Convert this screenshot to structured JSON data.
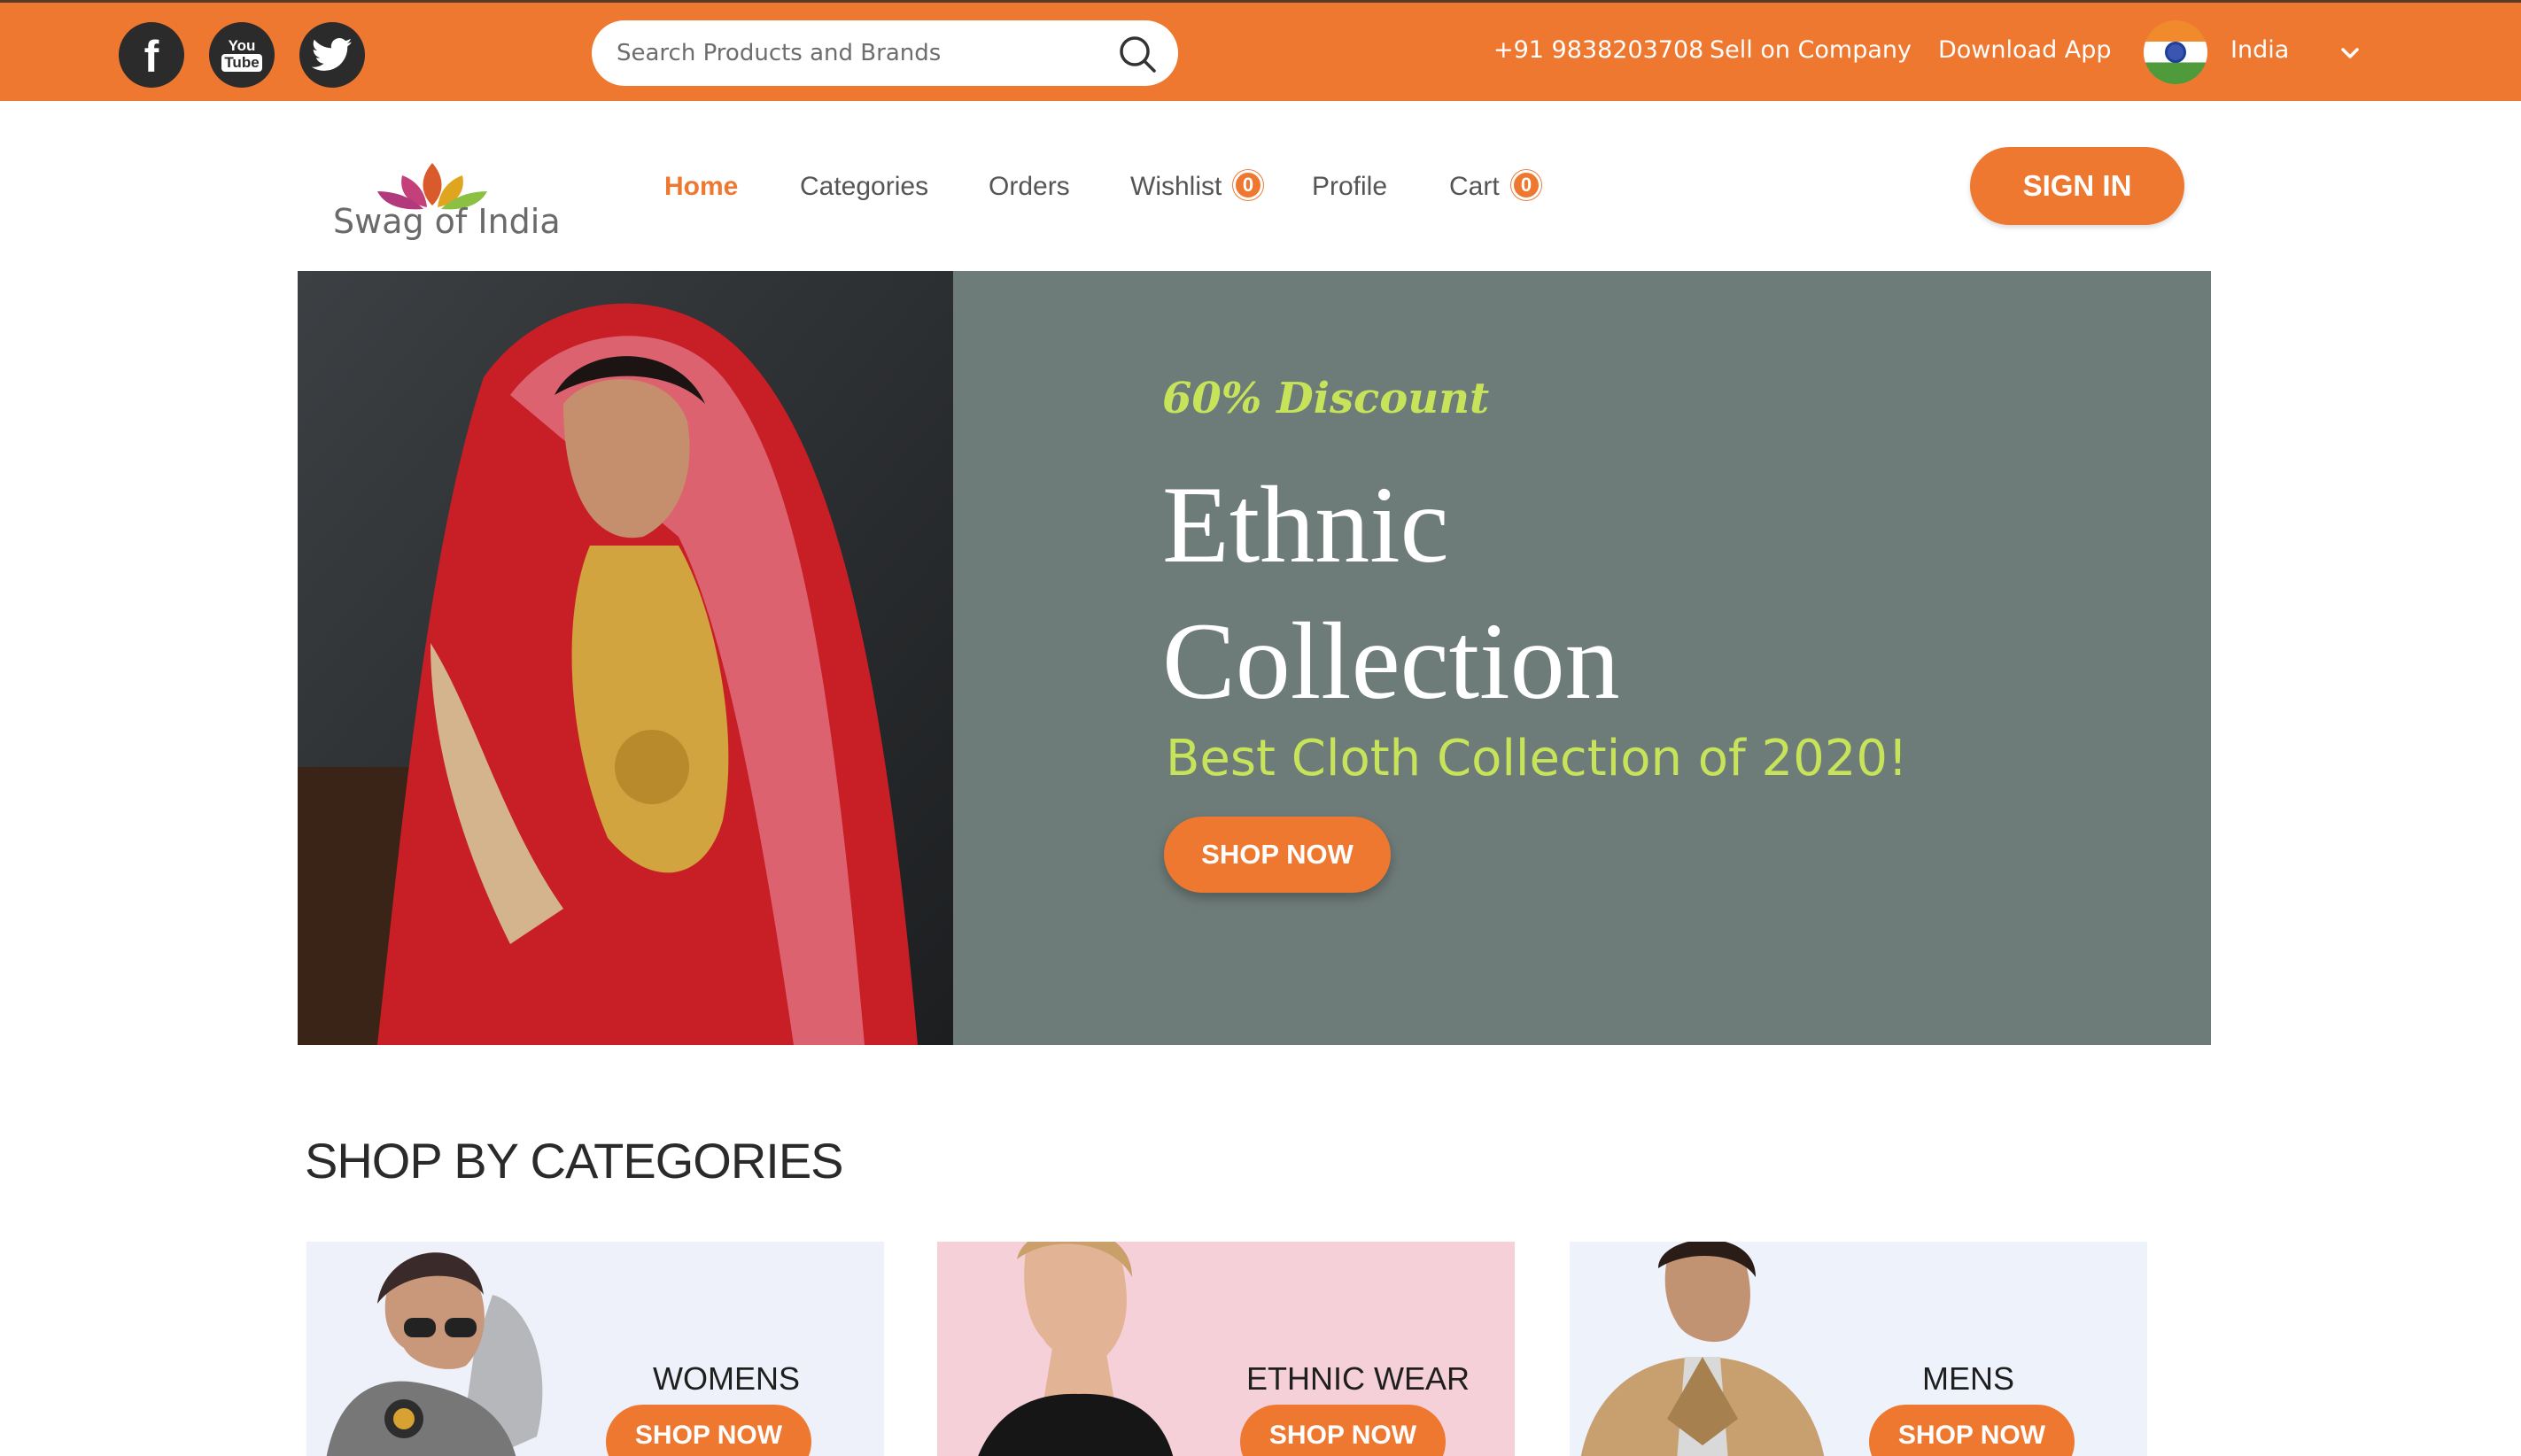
{
  "colors": {
    "brand_orange": "#ef7830",
    "lime_accent": "#c6e35a",
    "hero_bg": "#6d7b79",
    "social_icon_bg": "#2b2b2b"
  },
  "topbar": {
    "social": [
      {
        "name": "facebook-icon",
        "glyph": "f"
      },
      {
        "name": "youtube-icon",
        "glyph_top": "You",
        "glyph_bottom": "Tube"
      },
      {
        "name": "twitter-icon"
      }
    ],
    "search": {
      "placeholder": "Search Products and Brands",
      "value": ""
    },
    "phone": "+91 9838203708",
    "sell_link": "Sell on Company",
    "download_link": "Download App",
    "country": "India"
  },
  "nav": {
    "logo_text": "Swag of India",
    "items": [
      {
        "label": "Home",
        "active": true
      },
      {
        "label": "Categories",
        "active": false
      },
      {
        "label": "Orders",
        "active": false
      },
      {
        "label": "Wishlist",
        "active": false,
        "badge": "0"
      },
      {
        "label": "Profile",
        "active": false
      },
      {
        "label": "Cart",
        "active": false,
        "badge": "0"
      }
    ],
    "signin_label": "SIGN IN"
  },
  "hero": {
    "discount": "60% Discount",
    "title_line1": "Ethnic",
    "title_line2": "Collection",
    "subtitle": "Best Cloth Collection of 2020!",
    "button_label": "SHOP NOW"
  },
  "categories": {
    "title": "SHOP BY CATEGORIES",
    "cards": [
      {
        "name": "WOMENS",
        "button_label": "SHOP NOW",
        "bg": "#eef1f9"
      },
      {
        "name": "ETHNIC WEAR",
        "button_label": "SHOP NOW",
        "bg": "#f5d0d9"
      },
      {
        "name": "MENS",
        "button_label": "SHOP NOW",
        "bg": "#eef2fa"
      }
    ]
  }
}
